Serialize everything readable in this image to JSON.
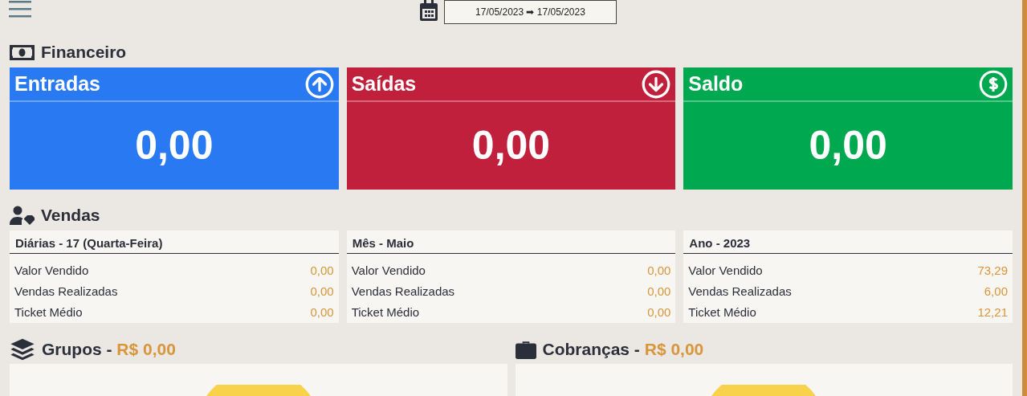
{
  "date_range": {
    "value": "17/05/2023 ➡ 17/05/2023"
  },
  "financeiro": {
    "title": "Financeiro",
    "cards": [
      {
        "kind": "up",
        "label": "Entradas",
        "value": "0,00",
        "color": "#2979f2"
      },
      {
        "kind": "down",
        "label": "Saídas",
        "value": "0,00",
        "color": "#c0203c"
      },
      {
        "kind": "dollar",
        "label": "Saldo",
        "value": "0,00",
        "color": "#00a84f"
      }
    ]
  },
  "vendas": {
    "title": "Vendas",
    "tables": [
      {
        "title": "Diárias - 17 (Quarta-Feira)",
        "rows": [
          {
            "label": "Valor Vendido",
            "value": "0,00"
          },
          {
            "label": "Vendas Realizadas",
            "value": "0,00"
          },
          {
            "label": "Ticket Médio",
            "value": "0,00"
          }
        ]
      },
      {
        "title": "Mês - Maio",
        "rows": [
          {
            "label": "Valor Vendido",
            "value": "0,00"
          },
          {
            "label": "Vendas Realizadas",
            "value": "0,00"
          },
          {
            "label": "Ticket Médio",
            "value": "0,00"
          }
        ]
      },
      {
        "title": "Ano - 2023",
        "rows": [
          {
            "label": "Valor Vendido",
            "value": "73,29"
          },
          {
            "label": "Vendas Realizadas",
            "value": "6,00"
          },
          {
            "label": "Ticket Médio",
            "value": "12,21"
          }
        ]
      }
    ]
  },
  "panels": [
    {
      "kind": "layers",
      "title": "Grupos -",
      "amount": "R$ 0,00"
    },
    {
      "kind": "briefcase",
      "title": "Cobranças -",
      "amount": "R$ 0,00"
    }
  ]
}
